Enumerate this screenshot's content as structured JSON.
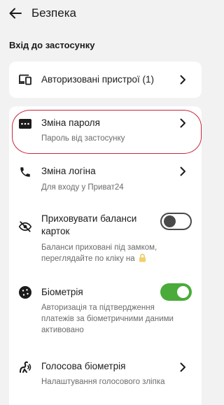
{
  "header": {
    "title": "Безпека"
  },
  "section": {
    "title": "Вхід до застосунку"
  },
  "devices": {
    "title": "Авторизовані пристрої (1)"
  },
  "items": [
    {
      "title": "Зміна пароля",
      "subtitle": "Пароль від застосунку"
    },
    {
      "title": "Зміна логіна",
      "subtitle": "Для входу у Приват24"
    },
    {
      "title_line1": "Приховувати баланси",
      "title_line2": "карток",
      "subtitle_line1": "Баланси приховані під замком,",
      "subtitle_line2": "переглядайте по кліку на",
      "toggle": "off"
    },
    {
      "title": "Біометрія",
      "subtitle_line1": "Авторизація та підтвердження",
      "subtitle_line2": "платежів за біометричними даними",
      "subtitle_line3": "активовано",
      "toggle": "on"
    },
    {
      "title": "Голосова біометрія",
      "subtitle": "Налаштування голосового зліпка"
    }
  ],
  "colors": {
    "accent_green": "#4aab3a",
    "highlight_red": "#c7283a",
    "background": "#f2f2f2"
  }
}
